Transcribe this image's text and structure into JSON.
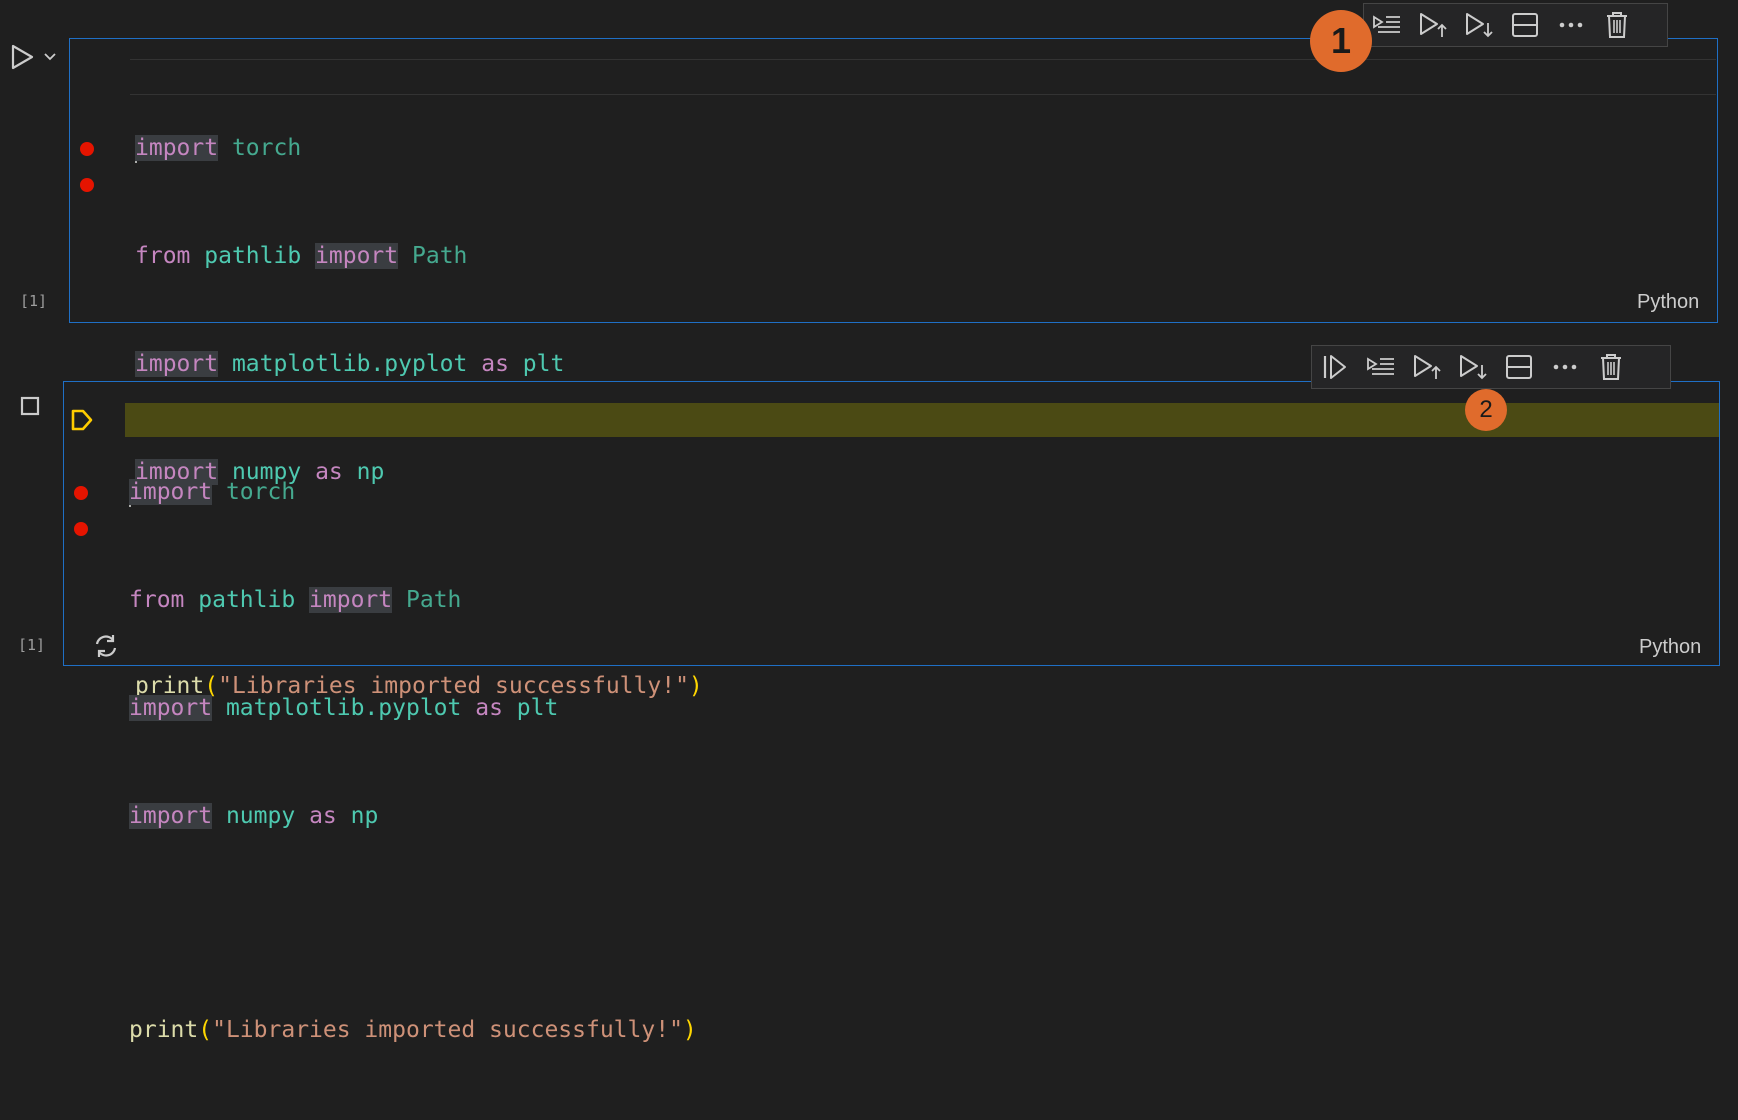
{
  "cells": [
    {
      "exec_count": "[1]",
      "language": "Python",
      "code": {
        "l1_kw": "import",
        "l1_mod": "torch",
        "l2_from": "from",
        "l2_mod": "pathlib",
        "l2_kw": "import",
        "l2_cls": "Path",
        "l3_kw": "import",
        "l3_mod": "matplotlib.pyplot",
        "l3_as": "as",
        "l3_alias": "plt",
        "l4_kw": "import",
        "l4_mod": "numpy",
        "l4_as": "as",
        "l4_alias": "np",
        "l6_fn": "print",
        "l6_open": "(",
        "l6_str": "\"Libraries imported successfully!\"",
        "l6_close": ")"
      }
    },
    {
      "exec_count": "[1]",
      "language": "Python",
      "code": {
        "l1_kw": "import",
        "l1_mod": "torch",
        "l2_from": "from",
        "l2_mod": "pathlib",
        "l2_kw": "import",
        "l2_cls": "Path",
        "l3_kw": "import",
        "l3_mod": "matplotlib.pyplot",
        "l3_as": "as",
        "l3_alias": "plt",
        "l4_kw": "import",
        "l4_mod": "numpy",
        "l4_as": "as",
        "l4_alias": "np",
        "l6_fn": "print",
        "l6_open": "(",
        "l6_str": "\"Libraries imported successfully!\"",
        "l6_close": ")"
      }
    }
  ],
  "badges": {
    "one": "1",
    "two": "2"
  },
  "colors": {
    "cell_border": "#1f6fc5",
    "breakpoint": "#e51400",
    "current_line": "#4b4a14",
    "badge": "#e06b2c"
  },
  "icons": {
    "toolbar1": [
      "execute-above-and-below-icon",
      "run-above-icon",
      "run-below-icon",
      "split-cell-icon",
      "more-actions-icon",
      "delete-icon"
    ],
    "toolbar2": [
      "run-by-line-icon",
      "execute-above-and-below-icon",
      "run-above-icon",
      "run-below-icon",
      "split-cell-icon",
      "more-actions-icon",
      "delete-icon"
    ]
  }
}
